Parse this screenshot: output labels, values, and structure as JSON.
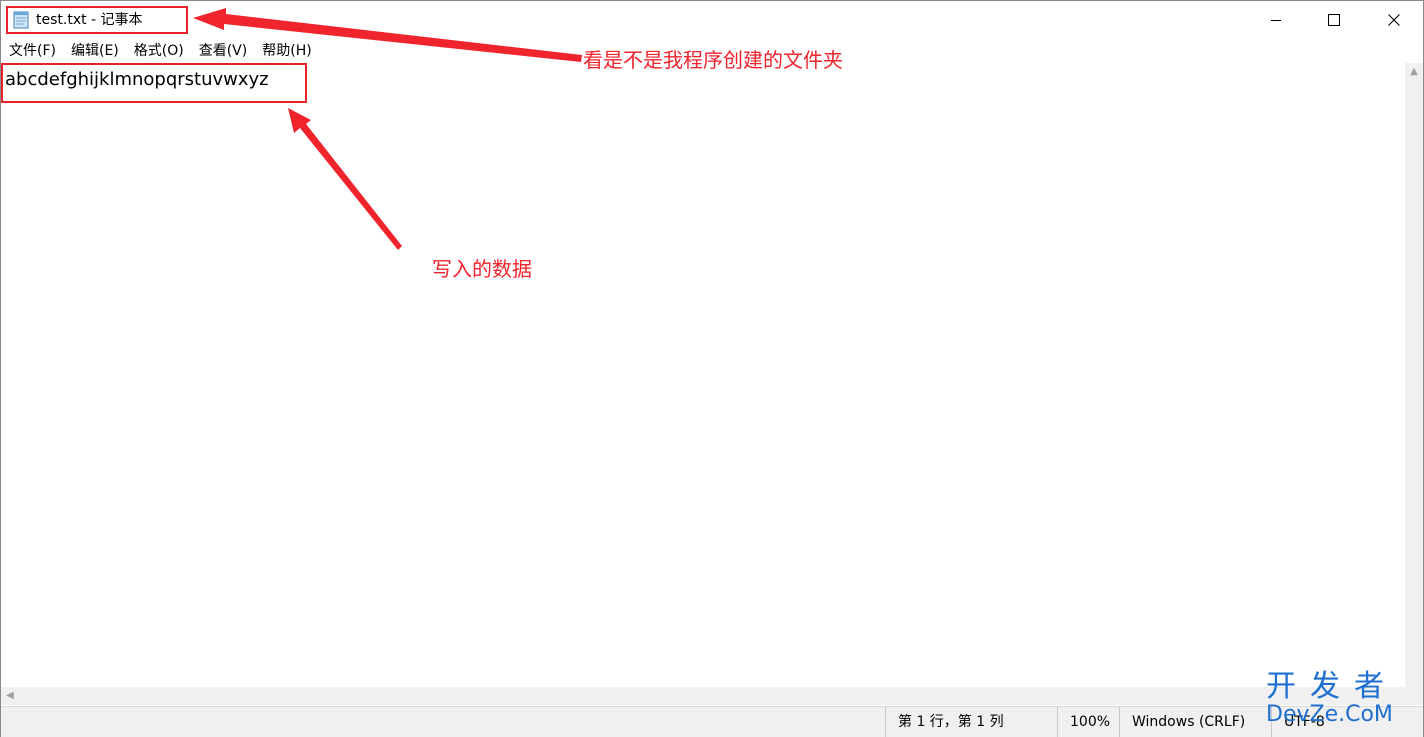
{
  "window": {
    "title": "test.txt - 记事本",
    "controls": [
      "minimize",
      "maximize",
      "close"
    ]
  },
  "menu": [
    {
      "label": "文件(F)"
    },
    {
      "label": "编辑(E)"
    },
    {
      "label": "格式(O)"
    },
    {
      "label": "查看(V)"
    },
    {
      "label": "帮助(H)"
    }
  ],
  "editor": {
    "content": "abcdefghijklmnopqrstuvwxyz"
  },
  "statusbar": {
    "position": "第 1 行，第 1 列",
    "zoom": "100%",
    "line_ending": "Windows (CRLF)",
    "encoding": "UTF-8"
  },
  "annotations": {
    "title_note": "看是不是我程序创建的文件夹",
    "content_note": "写入的数据",
    "color": "#e8202a"
  },
  "watermark": {
    "line1": "开发者",
    "line2": "DevZe.CoM"
  }
}
